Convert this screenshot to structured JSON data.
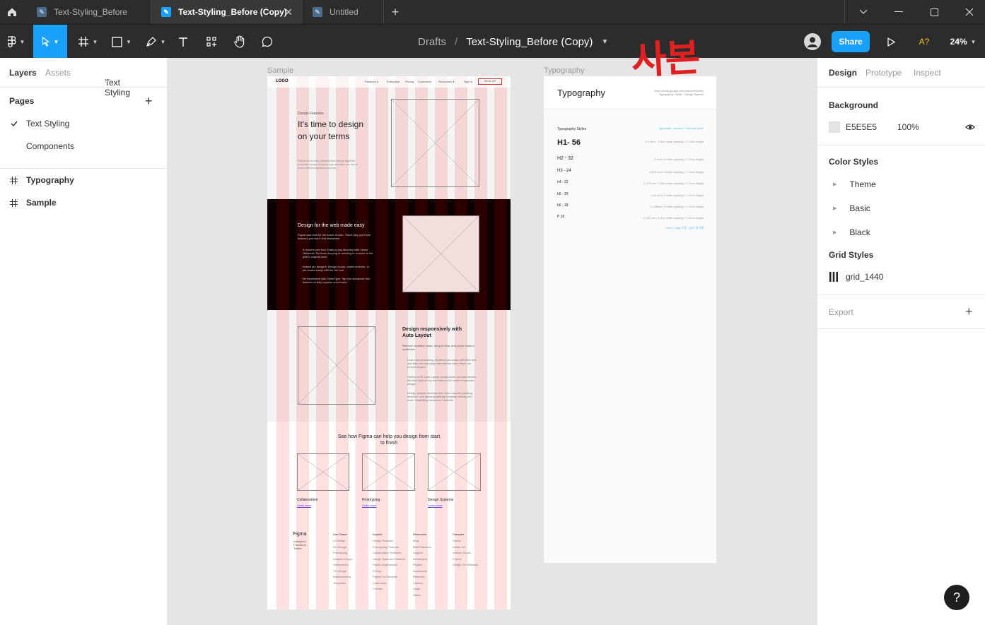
{
  "tabs": [
    {
      "label": "Text-Styling_Before"
    },
    {
      "label": "Text-Styling_Before (Copy)",
      "close": "✕"
    },
    {
      "label": "Untitled"
    }
  ],
  "toolbar": {
    "breadcrumb_root": "Drafts",
    "breadcrumb_sep": "/",
    "file_name": "Text-Styling_Before (Copy)",
    "annotation": "사본",
    "share_label": "Share",
    "font_warning": "A?",
    "zoom": "24%"
  },
  "left_panel": {
    "tab_layers": "Layers",
    "tab_assets": "Assets",
    "page_selector": "Text Styling",
    "pages_title": "Pages",
    "pages": [
      "Text Styling",
      "Components"
    ],
    "layers": [
      "Typography",
      "Sample"
    ]
  },
  "right_panel": {
    "tab_design": "Design",
    "tab_prototype": "Prototype",
    "tab_inspect": "Inspect",
    "background_title": "Background",
    "background_hex": "E5E5E5",
    "background_opacity": "100%",
    "color_styles_title": "Color Styles",
    "color_styles": [
      "Theme",
      "Basic",
      "Black"
    ],
    "grid_styles_title": "Grid Styles",
    "grid_style": "grid_1440",
    "export_title": "Export"
  },
  "canvas": {
    "sample_label": "Sample",
    "typography_label": "Typography",
    "sample": {
      "logo": "LOGO",
      "nav": [
        "Features ▾",
        "Enterprise",
        "Pricing",
        "Customers",
        "Resources ▾",
        "Sign in"
      ],
      "signup": "SIGN UP",
      "hero_eyebrow": "Design Features",
      "hero_title": "It's time to design on your terms",
      "hero_body": "Figma is the only platform that brings together powerful design features you already love and a more efficient workflow to boot.",
      "web_title": "Design for the web made easy",
      "web_body": "Figma was built for the future of web. That's why you'll see features you won't find elsewhere.",
      "web_bullets": [
        "A modern pen tool: Draw in any direction with Vector Networks. No down-looping or needing to connect to the path's original point.",
        "Instant arc designs: Design clocks, watch screens, or pie charts easily with the Arc tool.",
        "Be expressive with OpenType: Tap into advanced font features to fully express your brand."
      ],
      "auto_title": "Design responsively with Auto Layout",
      "auto_body": "Remove repetitive tasks, bring in data, and power custom workflows.",
      "auto_bullets": [
        "Less manual resizing: Buttons can resize with their text and lists can rearrange themselves when items are moved around.",
        "Stretch to fill: Auto Layout components can now stretch left and right (or top and bottom) for easier responsive design.",
        "Design speaks development: Auto Layout's padding, direction, and spacing settings translate directly into code, simplifying developer handoffs."
      ],
      "see_title": "See how Figma can help you design from start to finish",
      "cards": [
        {
          "title": "Collaboration",
          "link": "Learn more"
        },
        {
          "title": "Prototyping",
          "link": "Learn more"
        },
        {
          "title": "Design Systems",
          "link": "Learn more"
        }
      ],
      "footer_logo": "Figma",
      "footer_social": [
        "Instagram",
        "Facebook",
        "Twitter"
      ],
      "footer_cols": [
        {
          "title": "Use Cases",
          "items": [
            "UI Design",
            "UX Design",
            "Prototyping",
            "Graphic Design",
            "Wireframing",
            "VR Design",
            "Brainstorming",
            "Templates"
          ]
        },
        {
          "title": "Explore",
          "items": [
            "Design Features",
            "Prototyping Features",
            "Collaboration Features",
            "Design Systems Features",
            "Figma Organization",
            "Pricing",
            "Figma For Students",
            "Customers",
            "Contact"
          ]
        },
        {
          "title": "Resources",
          "items": [
            "Blog",
            "Best Practices",
            "Support",
            "Developers",
            "Plugins",
            "Downloads",
            "Releases",
            "Careers",
            "Legal",
            "Status"
          ]
        },
        {
          "title": "Compare",
          "items": [
            "Sketch",
            "Adobe XD",
            "Invision Studio",
            "Framer",
            "Design On Windows"
          ]
        }
      ]
    },
    "typography": {
      "title": "Typography",
      "meta": "https://fonts.google.com/specimen/Inter\nTypography Guide · Design System",
      "styles_title": "Typography Styles",
      "styles_link": "typescale · product · font-size scale",
      "styles": [
        {
          "name": "H1- 56",
          "spec": "3.5 rem / -0.5 px letter-spacing / 1.2 line-height"
        },
        {
          "name": "H2 - 32",
          "spec": "2 rem / 0 letter-spacing / 1.2 line-height"
        },
        {
          "name": "H3 - 24",
          "spec": "1.425 rem / 0 letter-spacing / 1.2 line-height"
        },
        {
          "name": "h4 - 22",
          "spec": "1.375 rem / 0.5px letter-spacing / 1.2 line-height"
        },
        {
          "name": "h5 - 20",
          "spec": "1.25 rem / 0 letter-spacing / 1.2 line-height"
        },
        {
          "name": "h6 - 18",
          "spec": "1.125rem / 0 letter-spacing / 1.2 line-height"
        },
        {
          "name": "P 18",
          "spec": "1.125 rem / 0.3 px letter-spacing / 1.6 line-height"
        }
      ],
      "footnote": "* rem = 16px 기준 · px는 참고용"
    }
  },
  "help": "?"
}
